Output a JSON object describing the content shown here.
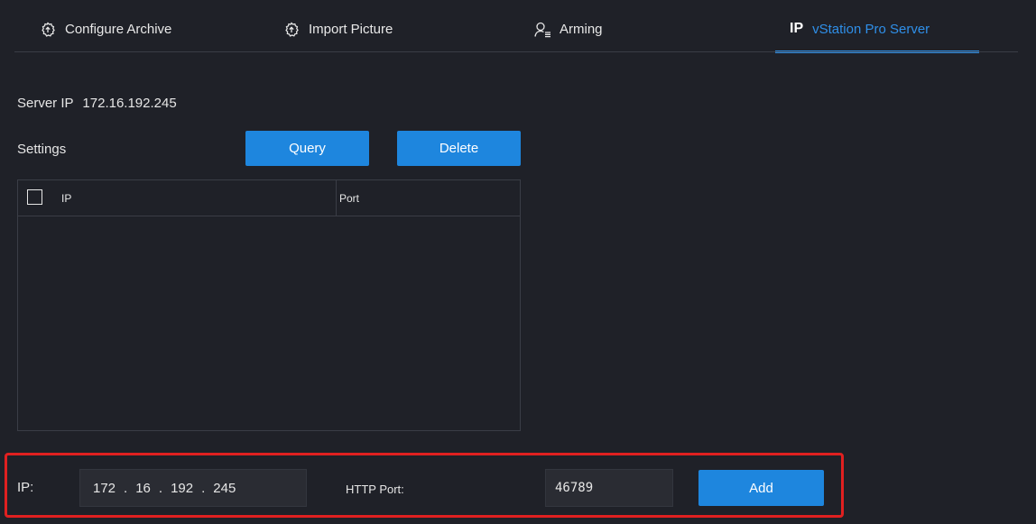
{
  "tabs": [
    {
      "label": "Configure Archive",
      "icon": "gear-upload-icon",
      "active": false
    },
    {
      "label": "Import Picture",
      "icon": "gear-upload-icon",
      "active": false
    },
    {
      "label": "Arming",
      "icon": "person-list-icon",
      "active": false
    },
    {
      "label": "vStation Pro Server",
      "icon": "ip-icon",
      "icon_text": "IP",
      "active": true
    }
  ],
  "server": {
    "label": "Server IP",
    "ip": "172.16.192.245"
  },
  "settings": {
    "label": "Settings",
    "query_label": "Query",
    "delete_label": "Delete"
  },
  "table": {
    "columns": [
      "IP",
      "Port"
    ],
    "rows": []
  },
  "add_form": {
    "ip_label": "IP:",
    "ip_octets": [
      "172",
      "16",
      "192",
      "245"
    ],
    "http_port_label": "HTTP Port:",
    "http_port_value": "46789",
    "add_label": "Add"
  },
  "colors": {
    "accent": "#1e86de",
    "background": "#1f2128",
    "highlight": "#e02020"
  }
}
